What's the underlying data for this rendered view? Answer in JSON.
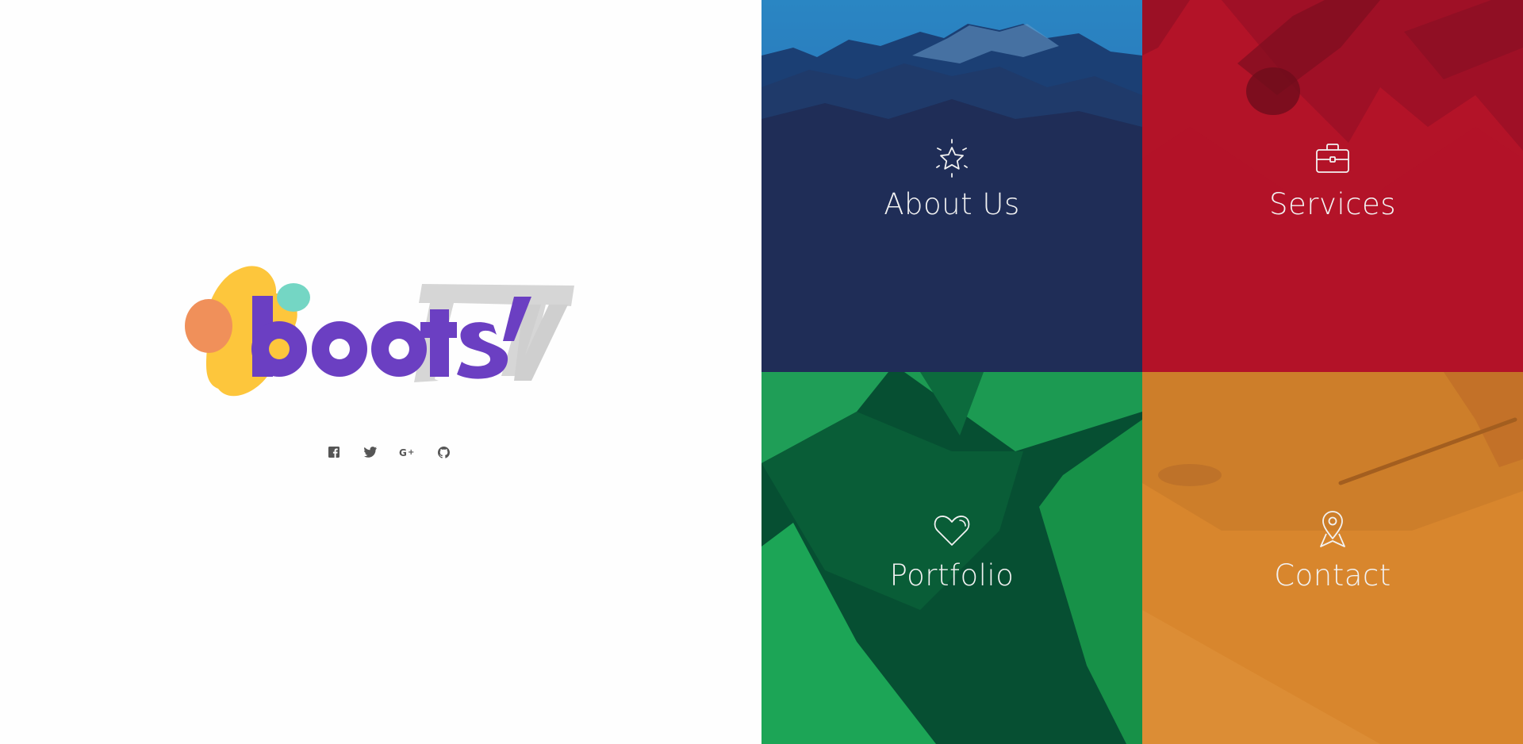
{
  "logo": {
    "text": "boots'",
    "secondary_mark": "TV",
    "colors": {
      "text": "#6b3fc2",
      "blob_yellow": "#fdc63c",
      "blob_orange": "#f0905a",
      "blob_teal": "#74d6c4",
      "tv_gray": "#d6d6d6"
    }
  },
  "social": [
    {
      "name": "facebook",
      "icon": "facebook-icon"
    },
    {
      "name": "twitter",
      "icon": "twitter-icon"
    },
    {
      "name": "google-plus",
      "icon": "google-plus-icon"
    },
    {
      "name": "github",
      "icon": "github-icon"
    }
  ],
  "tiles": [
    {
      "label": "About Us",
      "icon": "star-icon",
      "color": "#1f2d57"
    },
    {
      "label": "Services",
      "icon": "briefcase-icon",
      "color": "#b31328"
    },
    {
      "label": "Portfolio",
      "icon": "heart-icon",
      "color": "#064f32"
    },
    {
      "label": "Contact",
      "icon": "map-pin-icon",
      "color": "#d8862d"
    }
  ]
}
